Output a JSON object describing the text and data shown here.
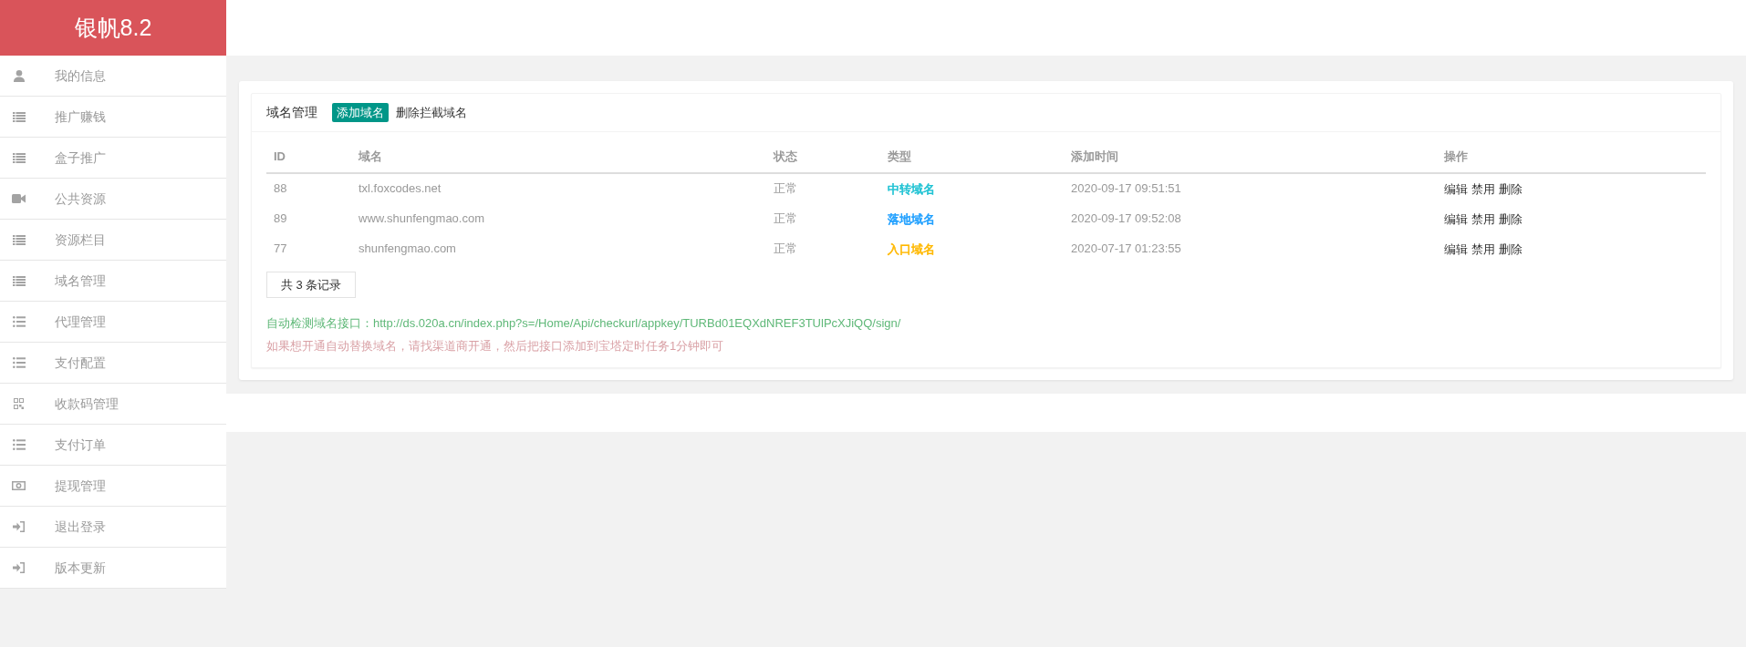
{
  "sidebar": {
    "title": "银帆8.2",
    "items": [
      {
        "label": "我的信息",
        "kind": "user"
      },
      {
        "label": "推广赚钱",
        "kind": "list"
      },
      {
        "label": "盒子推广",
        "kind": "list"
      },
      {
        "label": "公共资源",
        "kind": "camera"
      },
      {
        "label": "资源栏目",
        "kind": "list"
      },
      {
        "label": "域名管理",
        "kind": "list"
      },
      {
        "label": "代理管理",
        "kind": "bullets"
      },
      {
        "label": "支付配置",
        "kind": "bullets"
      },
      {
        "label": "收款码管理",
        "kind": "qrcode"
      },
      {
        "label": "支付订单",
        "kind": "bullets"
      },
      {
        "label": "提现管理",
        "kind": "banknote"
      },
      {
        "label": "退出登录",
        "kind": "enter"
      },
      {
        "label": "版本更新",
        "kind": "enter"
      }
    ]
  },
  "card": {
    "title": "域名管理",
    "actions": [
      {
        "label": "添加域名",
        "kind": "primary"
      },
      {
        "label": "删除拦截域名",
        "kind": "plain"
      }
    ],
    "table": {
      "columns": [
        "ID",
        "域名",
        "状态",
        "类型",
        "添加时间",
        "操作"
      ],
      "rows": [
        {
          "id": "88",
          "domain": "txl.foxcodes.net",
          "status": "正常",
          "type": {
            "label": "中转域名",
            "color": "#1ec2d3"
          },
          "added": "2020-09-17 09:51:51",
          "actions": [
            "编辑",
            "禁用",
            "删除"
          ]
        },
        {
          "id": "89",
          "domain": "www.shunfengmao.com",
          "status": "正常",
          "type": {
            "label": "落地域名",
            "color": "#1e9fff"
          },
          "added": "2020-09-17 09:52:08",
          "actions": [
            "编辑",
            "禁用",
            "删除"
          ]
        },
        {
          "id": "77",
          "domain": "shunfengmao.com",
          "status": "正常",
          "type": {
            "label": "入口域名",
            "color": "#ffb800"
          },
          "added": "2020-07-17 01:23:55",
          "actions": [
            "编辑",
            "禁用",
            "删除"
          ]
        }
      ]
    },
    "record_count": "共 3 条记录",
    "api_note": "自动检测域名接口：http://ds.020a.cn/index.php?s=/Home/Api/checkurl/appkey/TURBd01EQXdNREF3TUlPcXJiQQ/sign/",
    "hint": "如果想开通自动替换域名，请找渠道商开通，然后把接口添加到宝塔定时任务1分钟即可"
  }
}
